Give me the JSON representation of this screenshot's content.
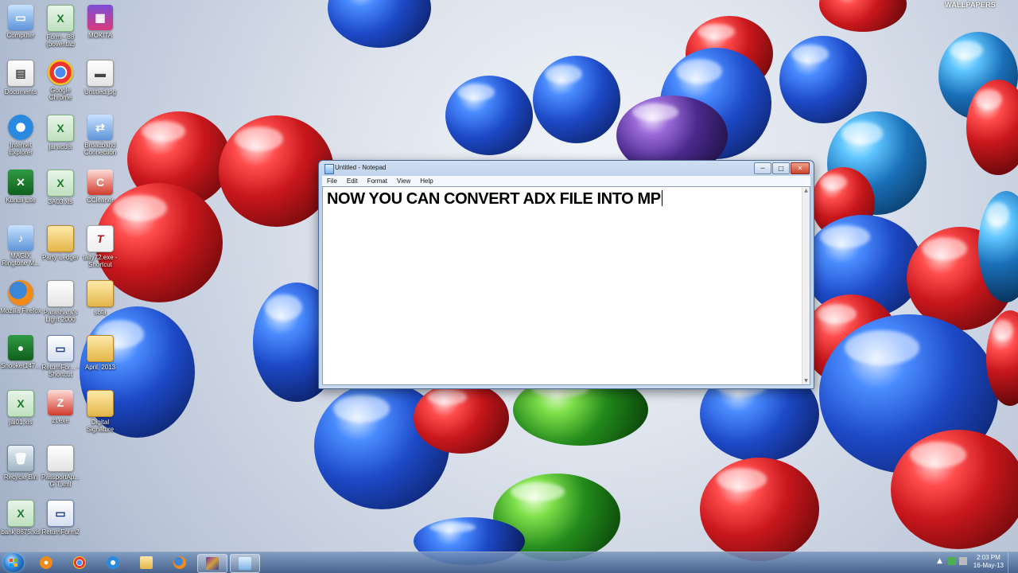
{
  "wallpaper": {
    "brand_text": "WALLPAPERS"
  },
  "desktop_icons": [
    {
      "label": "Computer",
      "icon": "computer-icon"
    },
    {
      "label": "Form - 88 (boventab",
      "icon": "excel-file-icon"
    },
    {
      "label": "MOKITA",
      "icon": "app-icon"
    },
    {
      "label": "Documents",
      "icon": "documents-icon"
    },
    {
      "label": "Google Chrome",
      "icon": "chrome-icon"
    },
    {
      "label": "Untitled.jpg",
      "icon": "image-file-icon"
    },
    {
      "label": "Internet Explorer",
      "icon": "internet-explorer-icon"
    },
    {
      "label": "jai.acdls",
      "icon": "excel-file-icon"
    },
    {
      "label": "Broadband Connection",
      "icon": "network-connection-icon"
    },
    {
      "label": "Kundli Lite",
      "icon": "kundli-icon"
    },
    {
      "label": "3A03.xls",
      "icon": "excel-file-icon"
    },
    {
      "label": "CCleaner",
      "icon": "ccleaner-icon"
    },
    {
      "label": "MAGIX Ringtone M...",
      "icon": "magix-icon"
    },
    {
      "label": "Party Ledger",
      "icon": "folder-icon"
    },
    {
      "label": "tally72.exe - Shortcut",
      "icon": "tally-icon"
    },
    {
      "label": "Mozilla Firefox",
      "icon": "firefox-icon"
    },
    {
      "label": "Parashara's Light 2000",
      "icon": "document-icon"
    },
    {
      "label": "sofa",
      "icon": "folder-icon"
    },
    {
      "label": "Snooker147...",
      "icon": "game-icon"
    },
    {
      "label": "ReturnFor... - Shortcut",
      "icon": "window-app-icon"
    },
    {
      "label": "April, 2013",
      "icon": "folder-icon"
    },
    {
      "label": "jai01.xls",
      "icon": "excel-file-icon"
    },
    {
      "label": "zt.exe",
      "icon": "zoo-tycoon-icon"
    },
    {
      "label": "Digital Signature",
      "icon": "folder-icon"
    },
    {
      "label": "Recycle Bin",
      "icon": "recycle-bin-icon"
    },
    {
      "label": "PassportAp... G T.xml",
      "icon": "document-icon"
    },
    {
      "label": "bank 8675.xls",
      "icon": "excel-file-icon"
    },
    {
      "label": "ReturnForm2",
      "icon": "window-app-icon"
    }
  ],
  "notepad": {
    "title": "Untitled - Notepad",
    "menu": [
      "File",
      "Edit",
      "Format",
      "View",
      "Help"
    ],
    "content": "NOW YOU CAN CONVERT ADX FILE INTO MP",
    "controls": {
      "minimize": "─",
      "maximize": "□",
      "close": "✕"
    }
  },
  "taskbar": {
    "pinned": [
      {
        "name": "media-player-icon",
        "active": false
      },
      {
        "name": "chrome-icon",
        "active": false
      },
      {
        "name": "internet-explorer-icon",
        "active": false
      },
      {
        "name": "file-explorer-icon",
        "active": false
      },
      {
        "name": "firefox-icon",
        "active": false
      },
      {
        "name": "winrar-icon",
        "active": true
      },
      {
        "name": "notepad-icon",
        "active": true
      }
    ],
    "clock_time": "2:03 PM",
    "clock_date": "16-May-13"
  },
  "colors": {
    "taskbar": "#4a6b96",
    "notepad_frame": "#c9d9ee",
    "close_button": "#c9422a"
  }
}
